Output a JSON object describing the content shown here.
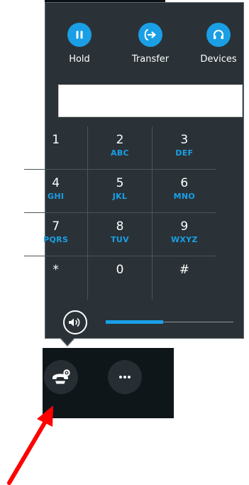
{
  "actions": {
    "hold": {
      "label": "Hold",
      "icon": "pause-icon"
    },
    "transfer": {
      "label": "Transfer",
      "icon": "transfer-icon"
    },
    "devices": {
      "label": "Devices",
      "icon": "headset-icon"
    }
  },
  "dial_display": {
    "value": ""
  },
  "keypad": {
    "k1": {
      "digit": "1",
      "letters": ""
    },
    "k2": {
      "digit": "2",
      "letters": "ABC"
    },
    "k3": {
      "digit": "3",
      "letters": "DEF"
    },
    "k4": {
      "digit": "4",
      "letters": "GHI"
    },
    "k5": {
      "digit": "5",
      "letters": "JKL"
    },
    "k6": {
      "digit": "6",
      "letters": "MNO"
    },
    "k7": {
      "digit": "7",
      "letters": "PQRS"
    },
    "k8": {
      "digit": "8",
      "letters": "TUV"
    },
    "k9": {
      "digit": "9",
      "letters": "WXYZ"
    },
    "kstar": {
      "digit": "*",
      "letters": ""
    },
    "k0": {
      "digit": "0",
      "letters": ""
    },
    "khash": {
      "digit": "#",
      "letters": ""
    }
  },
  "volume": {
    "level": 0.45,
    "icon": "speaker-icon"
  },
  "dock": {
    "call_controls_icon": "phone-settings-icon",
    "more_icon": "more-options-icon"
  },
  "colors": {
    "accent": "#1a9fe6",
    "panel": "#2a3237",
    "dock": "#0f161a",
    "annotation_arrow": "#ff0000"
  }
}
